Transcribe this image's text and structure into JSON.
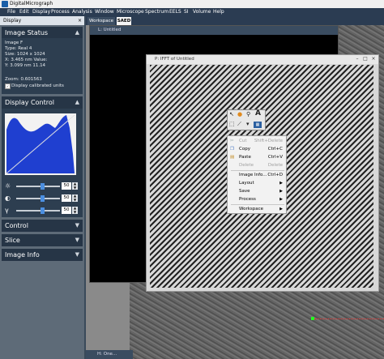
{
  "app": {
    "title": "DigitalMicrograph"
  },
  "menu": [
    "File",
    "Edit",
    "Display",
    "Process",
    "Analysis",
    "Window",
    "Microscope",
    "Spectrum",
    "EELS",
    "SI",
    "Volume",
    "Help"
  ],
  "display_panel": {
    "tab_label": "Display",
    "close": "×",
    "image_status": {
      "header": "Image Status",
      "lines": [
        "Image F",
        "Type:   Real 4",
        "Size:   1024 x 1024",
        "X:      3.465 nm       Value:",
        "Y:      3.099 nm        11.14",
        "",
        "Zoom:  0.601563",
        "Display calibrated units"
      ]
    },
    "display_control": {
      "header": "Display Control",
      "sliders": [
        {
          "symbol": "☼",
          "value": "50"
        },
        {
          "symbol": "◐",
          "value": "50"
        },
        {
          "symbol": "γ",
          "value": "50"
        }
      ]
    },
    "sections": [
      "Control",
      "Slice",
      "Image Info"
    ]
  },
  "workspace_tabs": [
    "Workspace 1",
    "SAED"
  ],
  "windows": {
    "l_title": "L: Untitled",
    "p_title": "P: IFFT of Untitled",
    "h_title": "H: One..."
  },
  "context_menu": {
    "items": [
      {
        "label": "Cut",
        "shortcut": "Shift+Delete",
        "disabled": true
      },
      {
        "label": "Copy",
        "shortcut": "Ctrl+C",
        "disabled": false
      },
      {
        "label": "Paste",
        "shortcut": "Ctrl+V",
        "disabled": false
      },
      {
        "label": "Delete",
        "shortcut": "Delete",
        "disabled": true
      },
      {
        "label": "Image Info...",
        "shortcut": "Ctrl+D",
        "disabled": false
      },
      {
        "label": "Layout",
        "shortcut": "",
        "disabled": false
      },
      {
        "label": "Save",
        "shortcut": "",
        "disabled": false
      },
      {
        "label": "Process",
        "shortcut": "",
        "disabled": false
      },
      {
        "label": "Workspace",
        "shortcut": "",
        "disabled": false
      }
    ]
  },
  "colors": {
    "accent": "#2b3c52",
    "histogram_fill": "#1f3fd0",
    "slider_knob": "#4c8fe0"
  }
}
